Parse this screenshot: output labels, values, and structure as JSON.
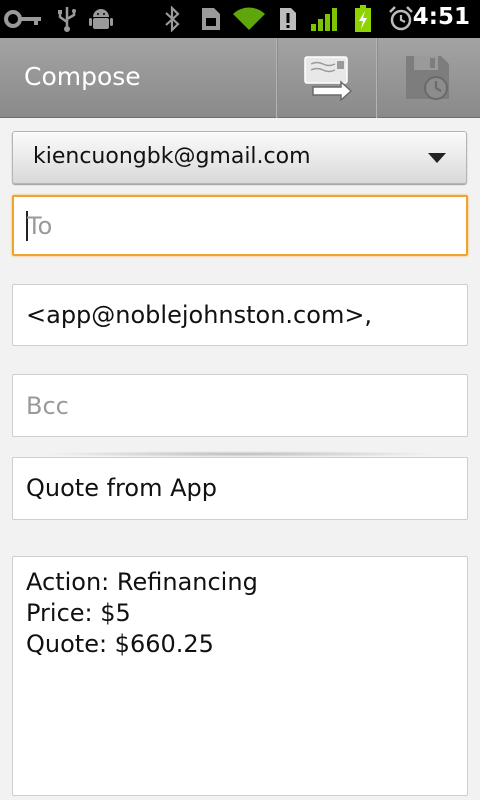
{
  "status_bar": {
    "time": "4:51",
    "icons": [
      "key-icon",
      "usb-icon",
      "android-debug-icon",
      "bluetooth-icon",
      "sim-icon",
      "wifi-icon",
      "alert-icon",
      "signal-icon",
      "battery-charging-icon",
      "alarm-icon"
    ]
  },
  "action_bar": {
    "title": "Compose",
    "actions": [
      "send-icon",
      "save-draft-icon"
    ]
  },
  "compose": {
    "from_account": "kiencuongbk@gmail.com",
    "to_placeholder": "To",
    "cc_value": "<app@noblejohnston.com>,",
    "bcc_placeholder": "Bcc",
    "subject": "Quote from App",
    "body_lines": [
      "Action: Refinancing",
      "Price: $5",
      "Quote: $660.25"
    ]
  },
  "colors": {
    "focus_border": "#f0a32d",
    "action_bar": "#9a9a9a",
    "battery_green": "#8fd400"
  }
}
